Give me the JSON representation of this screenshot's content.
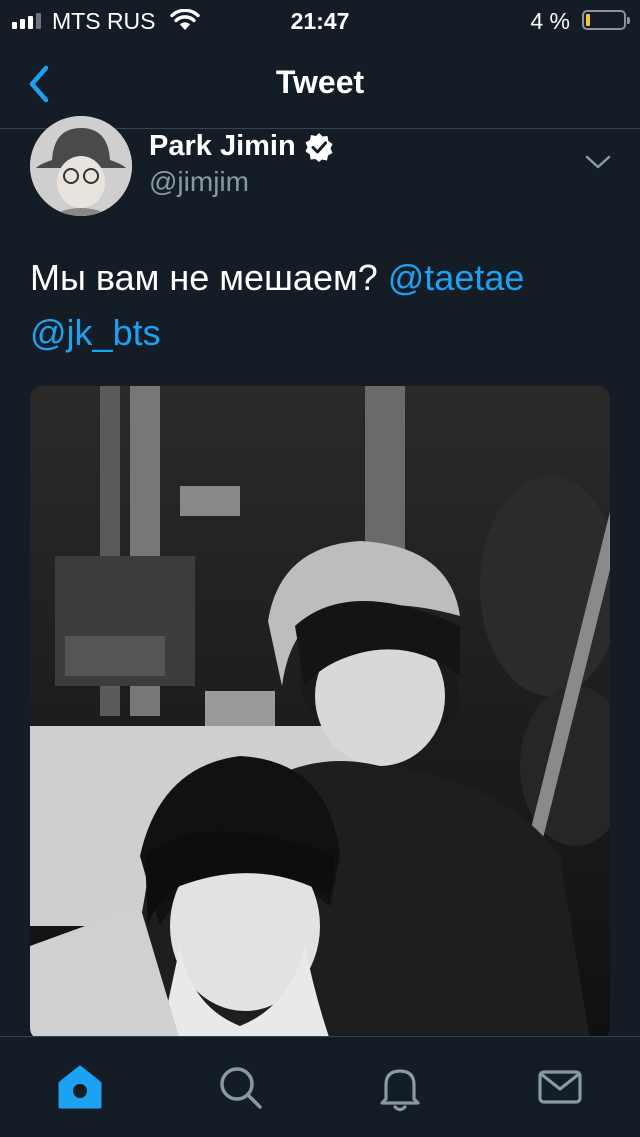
{
  "status_bar": {
    "carrier": "MTS RUS",
    "time": "21:47",
    "battery_percent": "4 %"
  },
  "nav": {
    "title": "Tweet"
  },
  "tweet": {
    "author_name": "Park Jimin",
    "author_handle": "@jimjim",
    "text": "Мы вам не мешаем?",
    "mentions": [
      "@taetae",
      "@jk_bts"
    ]
  },
  "colors": {
    "background": "#141d26",
    "accent": "#1da1f2",
    "secondary_text": "#8899a6",
    "divider": "#38444d"
  },
  "icons": {
    "back": "chevron-left-icon",
    "verified": "verified-badge-icon",
    "caret": "chevron-down-icon",
    "tabs": [
      "home-icon",
      "search-icon",
      "notifications-icon",
      "messages-icon"
    ]
  }
}
